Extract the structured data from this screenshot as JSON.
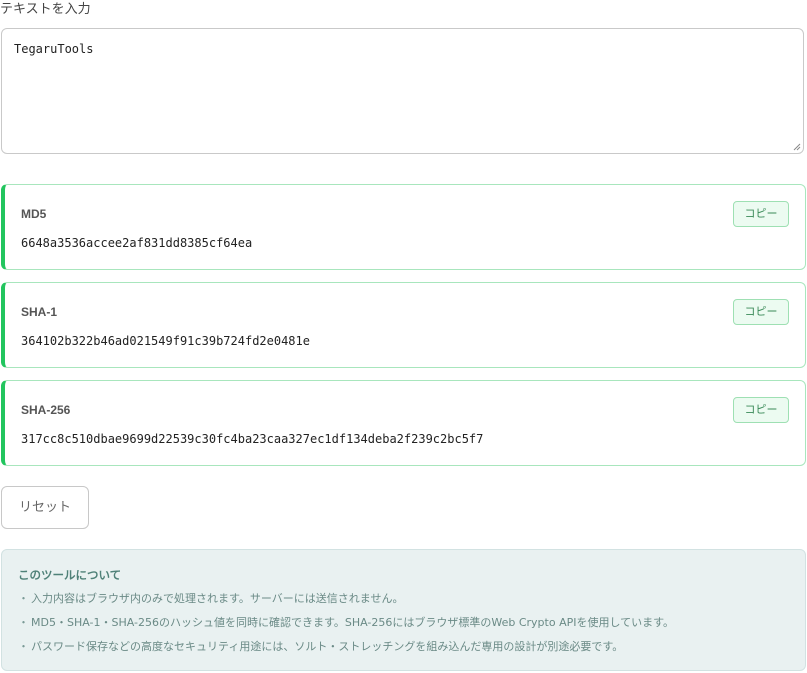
{
  "input": {
    "label": "テキストを入力",
    "value": "TegaruTools"
  },
  "hashes": [
    {
      "name": "MD5",
      "value": "6648a3536accee2af831dd8385cf64ea",
      "copy_label": "コピー"
    },
    {
      "name": "SHA-1",
      "value": "364102b322b46ad021549f91c39b724fd2e0481e",
      "copy_label": "コピー"
    },
    {
      "name": "SHA-256",
      "value": "317cc8c510dbae9699d22539c30fc4ba23caa327ec1df134deba2f239c2bc5f7",
      "copy_label": "コピー"
    }
  ],
  "reset_label": "リセット",
  "about": {
    "title": "このツールについて",
    "bullet": "・",
    "items": [
      "入力内容はブラウザ内のみで処理されます。サーバーには送信されません。",
      "MD5・SHA-1・SHA-256のハッシュ値を同時に確認できます。SHA-256にはブラウザ標準のWeb Crypto APIを使用しています。",
      "パスワード保存などの高度なセキュリティ用途には、ソルト・ストレッチングを組み込んだ専用の設計が別途必要です。"
    ]
  },
  "colors": {
    "accent": "#22c55e",
    "card_border": "#a8e6bd",
    "copy_bg": "#ecfbf1",
    "about_bg": "#e9f1f1",
    "about_title": "#4f8178"
  }
}
